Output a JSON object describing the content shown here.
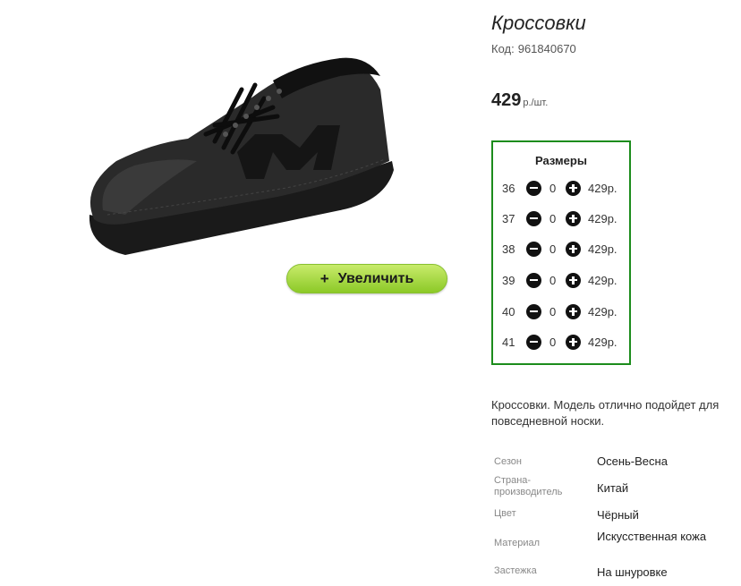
{
  "product": {
    "title": "Кроссовки",
    "code_label": "Код:",
    "code_value": "961840670",
    "price": "429",
    "price_unit": "р./шт."
  },
  "zoom": {
    "plus": "+",
    "label": "Увеличить"
  },
  "sizes": {
    "title": "Размеры",
    "rows": [
      {
        "size": "36",
        "qty": "0",
        "price": "429р."
      },
      {
        "size": "37",
        "qty": "0",
        "price": "429р."
      },
      {
        "size": "38",
        "qty": "0",
        "price": "429р."
      },
      {
        "size": "39",
        "qty": "0",
        "price": "429р."
      },
      {
        "size": "40",
        "qty": "0",
        "price": "429р."
      },
      {
        "size": "41",
        "qty": "0",
        "price": "429р."
      }
    ]
  },
  "description": "Кроссовки. Модель отлично подойдет для повседневной носки.",
  "specs": [
    {
      "label": "Сезон",
      "value": "Осень-Весна"
    },
    {
      "label": "Страна-производитель",
      "value": "Китай"
    },
    {
      "label": "Цвет",
      "value": "Чёрный"
    },
    {
      "label": "Материал",
      "value": "Искусственная кожа"
    },
    {
      "label": "Застежка",
      "value": "На шнуровке"
    }
  ],
  "colors": {
    "accent_green": "#1c8c1c",
    "button_green": "#9fd33a"
  },
  "icons": {
    "shoe": "sneaker-image",
    "minus": "minus-circle-icon",
    "plus": "plus-circle-icon"
  }
}
